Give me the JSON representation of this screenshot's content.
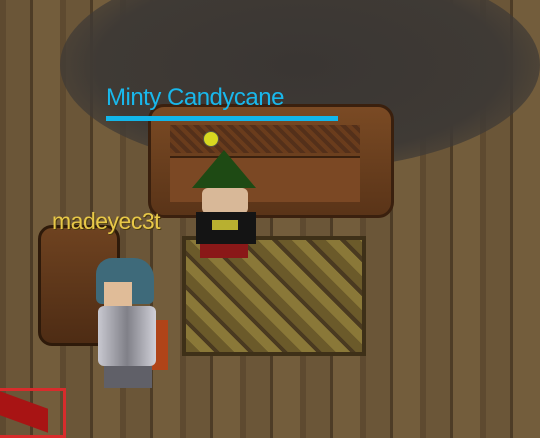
{
  "scene": {
    "npc": {
      "name": "Minty Candycane",
      "name_color": "#19b8ec"
    },
    "player": {
      "name": "madeyec3t",
      "name_color": "#e8c848"
    }
  }
}
